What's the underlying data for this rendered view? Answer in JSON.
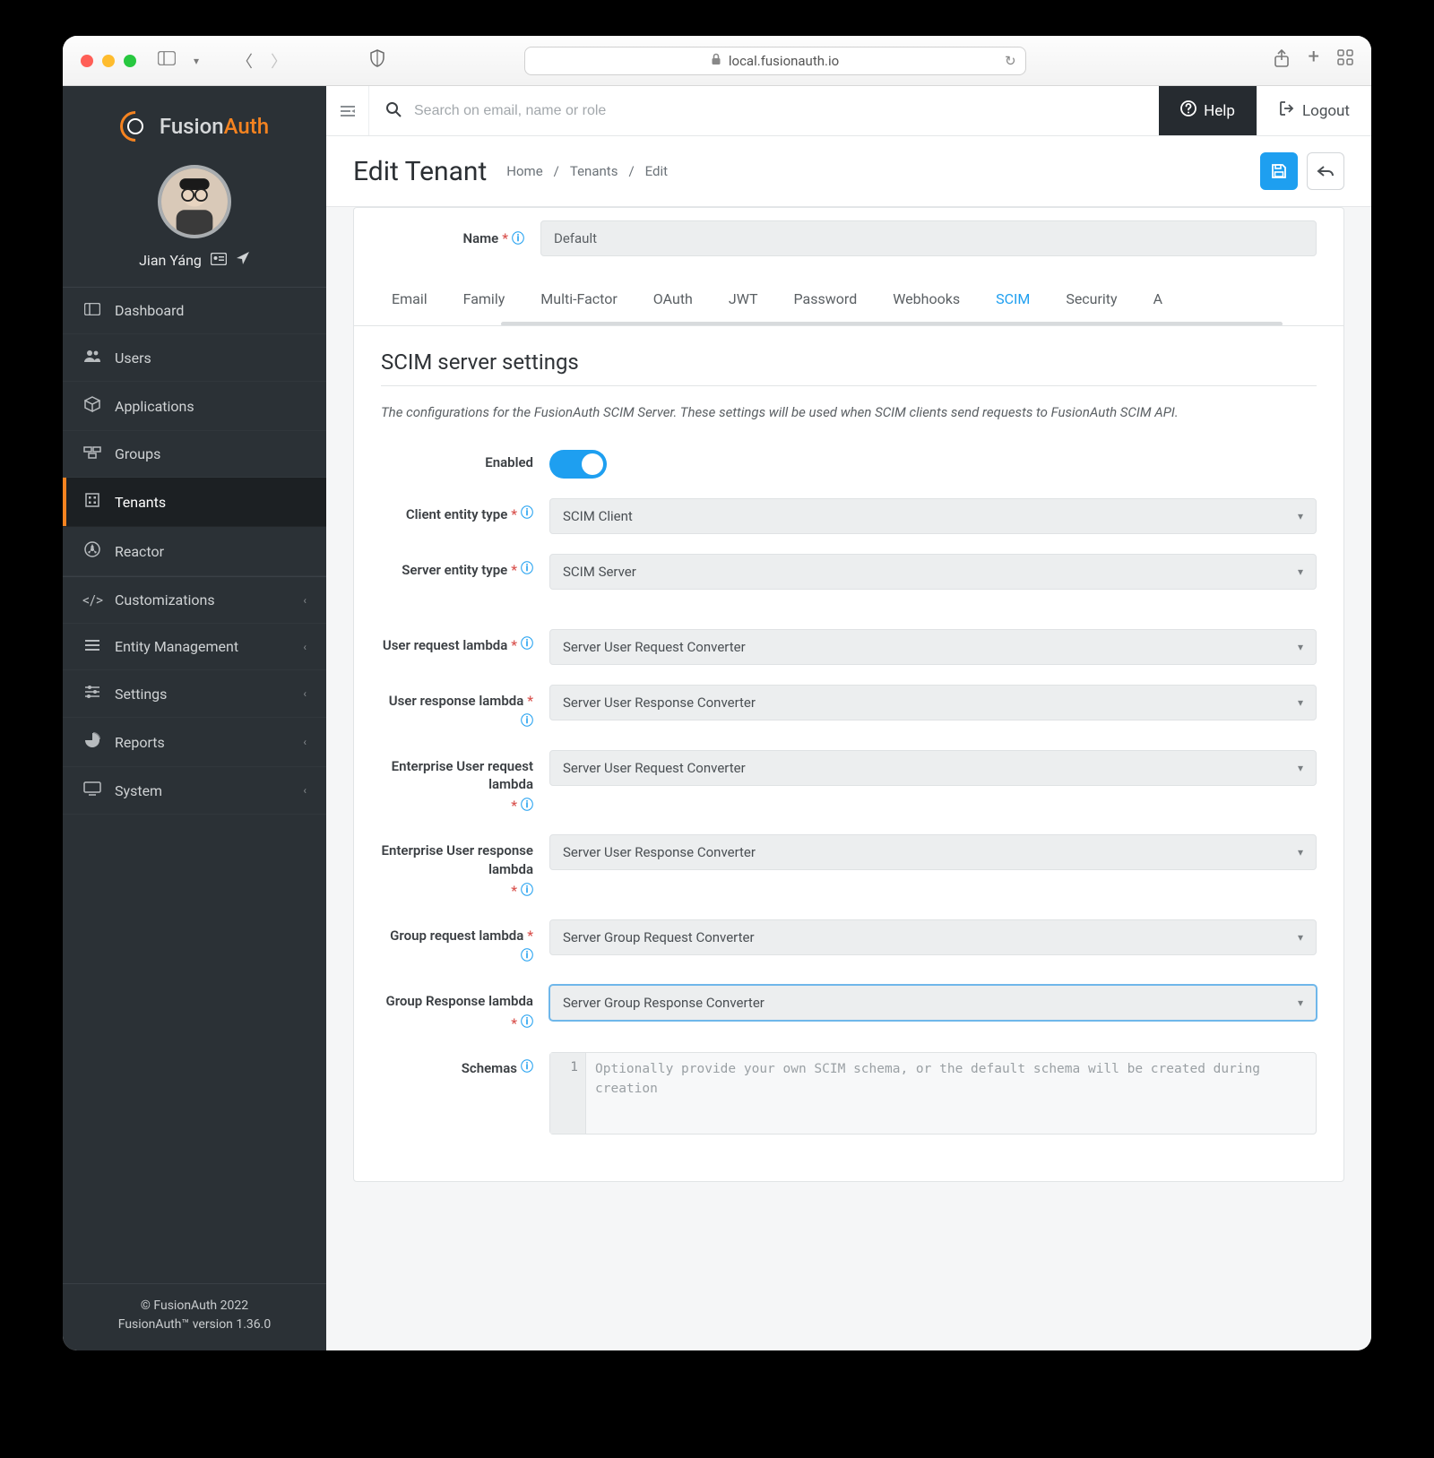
{
  "browser": {
    "url": "local.fusionauth.io"
  },
  "brand": {
    "name_a": "Fusion",
    "name_b": "Auth"
  },
  "user": {
    "name": "Jian Yáng"
  },
  "sidebar": {
    "items": [
      {
        "label": "Dashboard"
      },
      {
        "label": "Users"
      },
      {
        "label": "Applications"
      },
      {
        "label": "Groups"
      },
      {
        "label": "Tenants"
      },
      {
        "label": "Reactor"
      },
      {
        "label": "Customizations"
      },
      {
        "label": "Entity Management"
      },
      {
        "label": "Settings"
      },
      {
        "label": "Reports"
      },
      {
        "label": "System"
      }
    ],
    "footer_line1": "© FusionAuth 2022",
    "footer_line2": "FusionAuth™ version 1.36.0"
  },
  "topbar": {
    "search_placeholder": "Search on email, name or role",
    "help": "Help",
    "logout": "Logout"
  },
  "header": {
    "title": "Edit Tenant",
    "crumb1": "Home",
    "crumb2": "Tenants",
    "crumb3": "Edit"
  },
  "name_field": {
    "label": "Name",
    "value": "Default"
  },
  "tabs": [
    "Email",
    "Family",
    "Multi-Factor",
    "OAuth",
    "JWT",
    "Password",
    "Webhooks",
    "SCIM",
    "Security",
    "A"
  ],
  "tabs_active_index": 7,
  "scim": {
    "heading": "SCIM server settings",
    "description": "The configurations for the FusionAuth SCIM Server. These settings will be used when SCIM clients send requests to FusionAuth SCIM API.",
    "enabled_label": "Enabled",
    "fields": [
      {
        "label": "Client entity type",
        "value": "SCIM Client"
      },
      {
        "label": "Server entity type",
        "value": "SCIM Server"
      }
    ],
    "lambdas": [
      {
        "label": "User request lambda",
        "value": "Server User Request Converter"
      },
      {
        "label": "User response lambda",
        "value": "Server User Response Converter"
      },
      {
        "label": "Enterprise User request lambda",
        "value": "Server User Request Converter"
      },
      {
        "label": "Enterprise User response lambda",
        "value": "Server User Response Converter"
      },
      {
        "label": "Group request lambda",
        "value": "Server Group Request Converter"
      },
      {
        "label": "Group Response lambda",
        "value": "Server Group Response Converter"
      }
    ],
    "schemas_label": "Schemas",
    "schemas_placeholder": "Optionally provide your own SCIM schema, or the default schema will be created during creation"
  }
}
